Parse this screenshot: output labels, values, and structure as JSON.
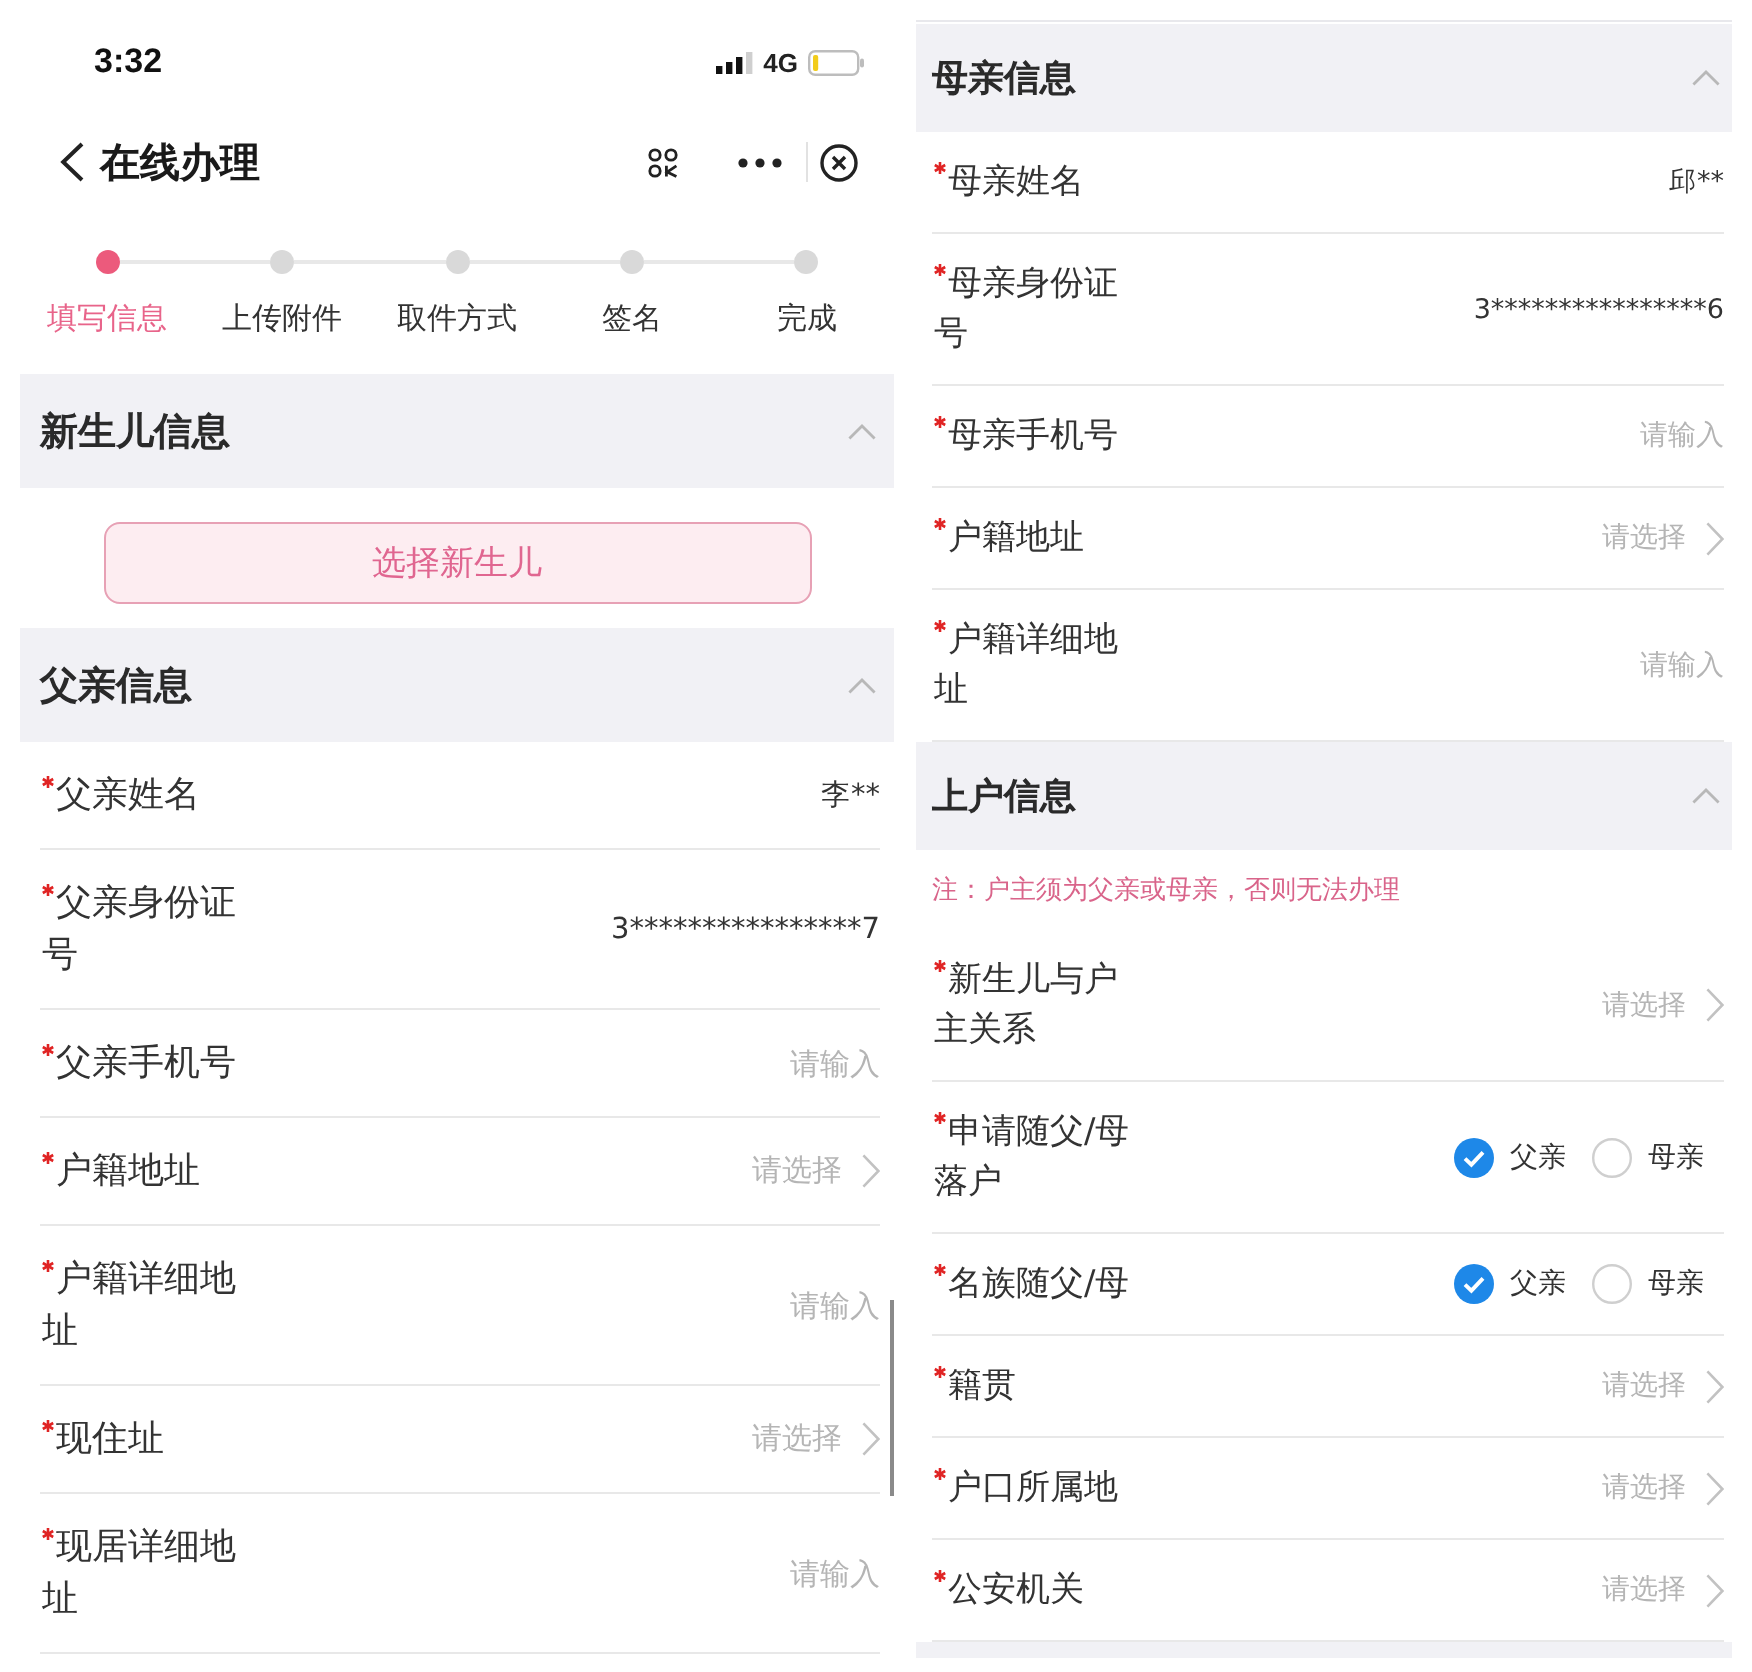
{
  "left_screen": {
    "status_bar": {
      "time": "3:32",
      "network": "4G"
    },
    "nav_bar": {
      "title": "在线办理"
    },
    "steps": [
      {
        "label": "填写信息",
        "selected": true
      },
      {
        "label": "上传附件",
        "selected": false
      },
      {
        "label": "取件方式",
        "selected": false
      },
      {
        "label": "签名",
        "selected": false
      },
      {
        "label": "完成",
        "selected": false
      }
    ],
    "sections": [
      {
        "title": "新生儿信息",
        "expanded": true,
        "button": "选择新生儿"
      },
      {
        "title": "父亲信息",
        "expanded": true,
        "fields": [
          {
            "kind": "value",
            "required": true,
            "label": "父亲姓名",
            "value": "李**"
          },
          {
            "kind": "value",
            "required": true,
            "label": "父亲身份证号",
            "value": "3****************7"
          },
          {
            "kind": "input",
            "required": true,
            "label": "父亲手机号",
            "placeholder": "请输入"
          },
          {
            "kind": "select",
            "required": true,
            "label": "户籍地址",
            "placeholder": "请选择"
          },
          {
            "kind": "input",
            "required": true,
            "label": "户籍详细地址",
            "placeholder": "请输入"
          },
          {
            "kind": "select",
            "required": true,
            "label": "现住址",
            "placeholder": "请选择"
          },
          {
            "kind": "input",
            "required": true,
            "label": "现居详细地址",
            "placeholder": "请输入"
          }
        ]
      }
    ]
  },
  "right_screen": {
    "sections": [
      {
        "title": "母亲信息",
        "expanded": true,
        "fields": [
          {
            "kind": "value",
            "required": true,
            "label": "母亲姓名",
            "value": "邱**"
          },
          {
            "kind": "value",
            "required": true,
            "label": "母亲身份证号",
            "value": "3****************6"
          },
          {
            "kind": "input",
            "required": true,
            "label": "母亲手机号",
            "placeholder": "请输入"
          },
          {
            "kind": "select",
            "required": true,
            "label": "户籍地址",
            "placeholder": "请选择"
          },
          {
            "kind": "input",
            "required": true,
            "label": "户籍详细地址",
            "placeholder": "请输入"
          }
        ]
      },
      {
        "title": "上户信息",
        "expanded": true,
        "note": "注：户主须为父亲或母亲，否则无法办理",
        "fields": [
          {
            "kind": "select",
            "required": true,
            "label": "新生儿与户主关系",
            "placeholder": "请选择"
          },
          {
            "kind": "radio",
            "required": true,
            "label": "申请随父/母落户",
            "options": [
              {
                "label": "父亲",
                "selected": true
              },
              {
                "label": "母亲",
                "selected": false
              }
            ]
          },
          {
            "kind": "radio",
            "required": true,
            "label": "名族随父/母",
            "options": [
              {
                "label": "父亲",
                "selected": true
              },
              {
                "label": "母亲",
                "selected": false
              }
            ]
          },
          {
            "kind": "select",
            "required": true,
            "label": "籍贯",
            "placeholder": "请选择"
          },
          {
            "kind": "select",
            "required": true,
            "label": "户口所属地",
            "placeholder": "请选择"
          },
          {
            "kind": "select",
            "required": true,
            "label": "公安机关",
            "placeholder": "请选择"
          }
        ]
      }
    ]
  }
}
